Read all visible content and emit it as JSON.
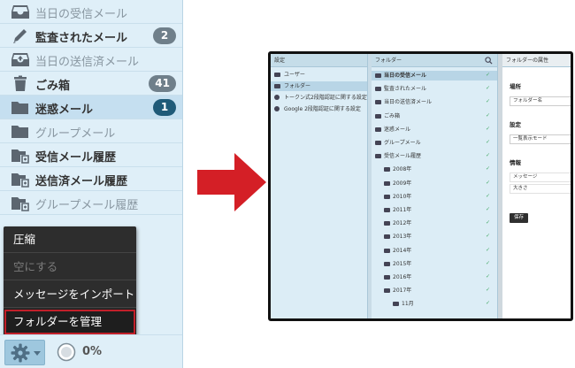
{
  "sidebar": {
    "folders": [
      {
        "label": "当日の受信メール",
        "icon": "inbox-icon",
        "badge": null,
        "bold": false
      },
      {
        "label": "監査されたメール",
        "icon": "pencil-icon",
        "badge": "2",
        "bold": true
      },
      {
        "label": "当日の送信済メール",
        "icon": "sent-tray-icon",
        "badge": null,
        "bold": false
      },
      {
        "label": "ごみ箱",
        "icon": "trash-icon",
        "badge": "41",
        "bold": true
      },
      {
        "label": "迷惑メール",
        "icon": "folder-icon",
        "badge": "1",
        "bold": true
      },
      {
        "label": "グループメール",
        "icon": "folder-icon",
        "badge": null,
        "bold": false
      },
      {
        "label": "受信メール履歴",
        "icon": "folder-history-icon",
        "badge": null,
        "bold": true
      },
      {
        "label": "送信済メール履歴",
        "icon": "folder-history-icon",
        "badge": null,
        "bold": true
      },
      {
        "label": "グループメール履歴",
        "icon": "folder-history-icon",
        "badge": null,
        "bold": false
      }
    ],
    "selected_index": 4,
    "context_menu": {
      "items": [
        {
          "label": "圧縮",
          "enabled": true
        },
        {
          "label": "空にする",
          "enabled": false
        },
        {
          "label": "メッセージをインポート",
          "enabled": true
        },
        {
          "label": "フォルダーを管理",
          "enabled": true,
          "highlighted": true
        }
      ]
    },
    "storage_percent": "0%",
    "storage_value": 0
  },
  "colors": {
    "badge_gray": "#6f7f8a",
    "badge_dark": "#1f5a78",
    "arrow_red": "#d41f26",
    "highlight_border": "#c2202a"
  },
  "mini": {
    "settings_panel": {
      "title": "設定",
      "items": [
        "ユーザー",
        "フォルダー",
        "トークン式2段階認証に関する設定",
        "Google 2段階認証に関する設定"
      ],
      "selected_index": 1
    },
    "folder_panel": {
      "title": "フォルダー",
      "items": [
        "当日の受信メール",
        "監査されたメール",
        "当日の送信済メール",
        "ごみ箱",
        "迷惑メール",
        "グループメール",
        "受信メール履歴",
        "2008年",
        "2009年",
        "2010年",
        "2011年",
        "2012年",
        "2013年",
        "2014年",
        "2015年",
        "2016年",
        "2017年",
        "11月"
      ],
      "selected_index": 0
    },
    "props_panel": {
      "title": "フォルダーの属性",
      "location_label": "場所",
      "location_value": "フォルダー名",
      "settings_label": "設定",
      "settings_value": "一覧表示モード",
      "info_label": "情報",
      "info_rows": [
        "メッセージ",
        "大きさ"
      ],
      "save_label": "保存"
    }
  }
}
